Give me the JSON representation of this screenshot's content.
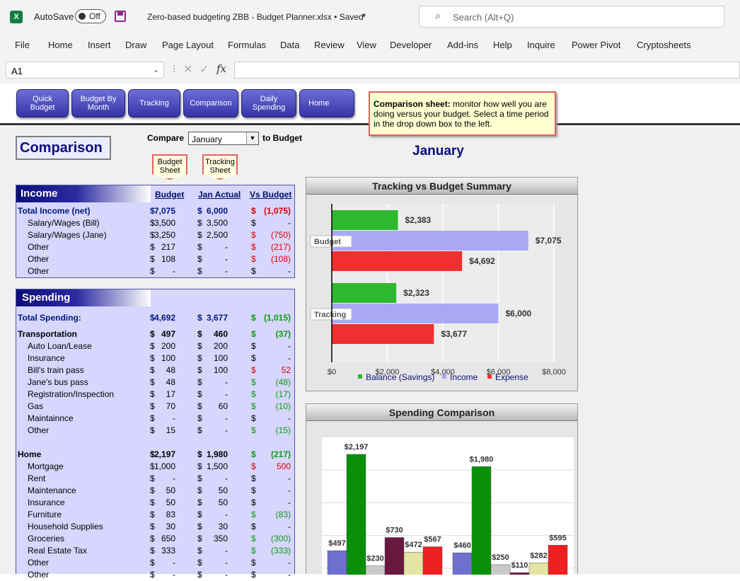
{
  "titlebar": {
    "autosave": "AutoSave",
    "toggle": "Off",
    "filename": "Zero-based budgeting ZBB - Budget Planner.xlsx • Saved",
    "search_placeholder": "Search (Alt+Q)"
  },
  "menu": [
    "File",
    "Home",
    "Insert",
    "Draw",
    "Page Layout",
    "Formulas",
    "Data",
    "Review",
    "View",
    "Developer",
    "Add-ins",
    "Help",
    "Inquire",
    "Power Pivot",
    "Cryptosheets"
  ],
  "formula": {
    "namebox": "A1",
    "fx": "fx",
    "value": ""
  },
  "nav_buttons": [
    "Quick Budget",
    "Budget By Month",
    "Tracking",
    "Comparison",
    "Daily Spending",
    "Home"
  ],
  "note": {
    "bold": "Comparison sheet:",
    "text": " monitor how well you are doing versus your budget.  Select a time period in the drop down box to the left."
  },
  "sheet_title": "Comparison",
  "compare": {
    "label": "Compare",
    "selected": "January",
    "suffix": "to Budget"
  },
  "month_title": "January",
  "pins": {
    "budget": "Budget Sheet",
    "tracking": "Tracking Sheet"
  },
  "income": {
    "title": "Income",
    "col1": "Budget",
    "col2": "Jan Actual",
    "col3": "Vs Budget",
    "rows": [
      {
        "label": "Total Income (net)",
        "b": "7,075",
        "a": "6,000",
        "v": "(1,075)",
        "vc": "neg",
        "t": "tot"
      },
      {
        "label": "Salary/Wages (Bill)",
        "b": "3,500",
        "a": "3,500",
        "v": "-",
        "vc": "",
        "t": "ind"
      },
      {
        "label": "Salary/Wages (Jane)",
        "b": "3,250",
        "a": "2,500",
        "v": "(750)",
        "vc": "neg",
        "t": "ind"
      },
      {
        "label": "Other",
        "b": "217",
        "a": "-",
        "v": "(217)",
        "vc": "neg",
        "t": "ind"
      },
      {
        "label": "Other",
        "b": "108",
        "a": "-",
        "v": "(108)",
        "vc": "neg",
        "t": "ind"
      },
      {
        "label": "Other",
        "b": "-",
        "a": "-",
        "v": "-",
        "vc": "",
        "t": "ind"
      }
    ]
  },
  "spending": {
    "title": "Spending",
    "rows": [
      {
        "label": "Total Spending:",
        "b": "4,692",
        "a": "3,677",
        "v": "(1,015)",
        "vc": "pos",
        "t": "tot",
        "top": 4
      },
      {
        "label": "Transportation",
        "b": "497",
        "a": "460",
        "v": "(37)",
        "vc": "pos",
        "t": "bold",
        "top": 27
      },
      {
        "label": "Auto Loan/Lease",
        "b": "200",
        "a": "200",
        "v": "-",
        "vc": "",
        "t": "ind",
        "top": 44
      },
      {
        "label": "Insurance",
        "b": "100",
        "a": "100",
        "v": "-",
        "vc": "",
        "t": "ind",
        "top": 61
      },
      {
        "label": "Bill's train pass",
        "b": "48",
        "a": "100",
        "v": "52",
        "vc": "neg",
        "t": "ind",
        "top": 78
      },
      {
        "label": "Jane's bus pass",
        "b": "48",
        "a": "-",
        "v": "(48)",
        "vc": "pos",
        "t": "ind",
        "top": 95
      },
      {
        "label": "Registration/Inspection",
        "b": "17",
        "a": "-",
        "v": "(17)",
        "vc": "pos",
        "t": "ind",
        "top": 112
      },
      {
        "label": "Gas",
        "b": "70",
        "a": "60",
        "v": "(10)",
        "vc": "pos",
        "t": "ind",
        "top": 129
      },
      {
        "label": "Maintainnce",
        "b": "-",
        "a": "-",
        "v": "-",
        "vc": "",
        "t": "ind",
        "top": 146
      },
      {
        "label": "Other",
        "b": "15",
        "a": "-",
        "v": "(15)",
        "vc": "pos",
        "t": "ind",
        "top": 163
      },
      {
        "label": "Home",
        "b": "2,197",
        "a": "1,980",
        "v": "(217)",
        "vc": "pos",
        "t": "bold",
        "top": 197
      },
      {
        "label": "Mortgage",
        "b": "1,000",
        "a": "1,500",
        "v": "500",
        "vc": "neg",
        "t": "ind",
        "top": 214
      },
      {
        "label": "Rent",
        "b": "-",
        "a": "-",
        "v": "-",
        "vc": "",
        "t": "ind",
        "top": 231
      },
      {
        "label": "Maintenance",
        "b": "50",
        "a": "50",
        "v": "-",
        "vc": "",
        "t": "ind",
        "top": 248
      },
      {
        "label": "Insurance",
        "b": "50",
        "a": "50",
        "v": "-",
        "vc": "",
        "t": "ind",
        "top": 265
      },
      {
        "label": "Furniture",
        "b": "83",
        "a": "-",
        "v": "(83)",
        "vc": "pos",
        "t": "ind",
        "top": 282
      },
      {
        "label": "Household Supplies",
        "b": "30",
        "a": "30",
        "v": "-",
        "vc": "",
        "t": "ind",
        "top": 299
      },
      {
        "label": "Groceries",
        "b": "650",
        "a": "350",
        "v": "(300)",
        "vc": "pos",
        "t": "ind",
        "top": 316
      },
      {
        "label": "Real Estate Tax",
        "b": "333",
        "a": "-",
        "v": "(333)",
        "vc": "pos",
        "t": "ind",
        "top": 333
      },
      {
        "label": "Other",
        "b": "-",
        "a": "-",
        "v": "-",
        "vc": "",
        "t": "ind",
        "top": 350
      },
      {
        "label": "Other",
        "b": "-",
        "a": "-",
        "v": "-",
        "vc": "",
        "t": "ind",
        "top": 367
      }
    ]
  },
  "chart_data": [
    {
      "type": "bar",
      "title": "Tracking vs Budget Summary",
      "orientation": "horizontal",
      "categories": [
        "Budget",
        "Tracking"
      ],
      "series": [
        {
          "name": "Balance (Savings)",
          "values": [
            2383,
            2323
          ],
          "color": "#2fb82f"
        },
        {
          "name": "Income",
          "values": [
            7075,
            6000
          ],
          "color": "#a8a8f4"
        },
        {
          "name": "Expense",
          "values": [
            4692,
            3677
          ],
          "color": "#f03030"
        }
      ],
      "value_labels": {
        "Budget": [
          "$2,383",
          "$7,075",
          "$4,692"
        ],
        "Tracking": [
          "$2,323",
          "$6,000",
          "$3,677"
        ]
      },
      "xlim": [
        0,
        8000
      ],
      "xticks": [
        "$0",
        "$2,000",
        "$4,000",
        "$6,000",
        "$8,000"
      ],
      "legend": "bottom",
      "grid": true
    },
    {
      "type": "bar",
      "title": "Spending Comparison",
      "groups": [
        {
          "bars": [
            {
              "value": 497,
              "label": "$497",
              "color": "#6f6fd0"
            },
            {
              "value": 2197,
              "label": "$2,197",
              "color": "#0a8f0a"
            },
            {
              "value": 230,
              "label": "$230",
              "color": "#c8c8c8"
            },
            {
              "value": 730,
              "label": "$730",
              "color": "#6b1840"
            },
            {
              "value": 472,
              "label": "$472",
              "color": "#e4e4a4"
            },
            {
              "value": 567,
              "label": "$567",
              "color": "#ee2020"
            }
          ]
        },
        {
          "bars": [
            {
              "value": 460,
              "label": "$460",
              "color": "#6f6fd0"
            },
            {
              "value": 1980,
              "label": "$1,980",
              "color": "#0a8f0a"
            },
            {
              "value": 250,
              "label": "$250",
              "color": "#c8c8c8"
            },
            {
              "value": 110,
              "label": "$110",
              "color": "#6b1840"
            },
            {
              "value": 282,
              "label": "$282",
              "color": "#e4e4a4"
            },
            {
              "value": 595,
              "label": "$595",
              "color": "#ee2020"
            }
          ]
        }
      ],
      "ylim": [
        0,
        2500
      ],
      "grid": true
    }
  ]
}
